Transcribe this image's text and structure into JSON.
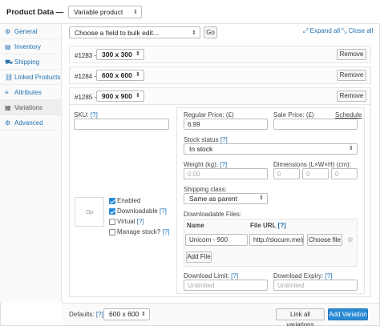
{
  "header": {
    "title": "Product Data —",
    "product_type": "Variable product"
  },
  "sidebar": {
    "items": [
      {
        "label": "General",
        "icon": "wrench-icon",
        "glyph": "⚙"
      },
      {
        "label": "Inventory",
        "icon": "inventory-icon",
        "glyph": "▤"
      },
      {
        "label": "Shipping",
        "icon": "truck-icon",
        "glyph": "⛟"
      },
      {
        "label": "Linked Products",
        "icon": "link-icon",
        "glyph": "⛓"
      },
      {
        "label": "Attributes",
        "icon": "list-icon",
        "glyph": "≡"
      },
      {
        "label": "Variations",
        "icon": "grid-icon",
        "glyph": "▦"
      },
      {
        "label": "Advanced",
        "icon": "gear-icon",
        "glyph": "⚙"
      }
    ],
    "active": "Variations"
  },
  "toolbar": {
    "bulk_select": "Choose a field to bulk edit...",
    "go_label": "Go",
    "expand_all": "Expand all",
    "close_all": "Close all"
  },
  "variations": [
    {
      "id": "#1283 —",
      "size": "300 x 300",
      "remove": "Remove"
    },
    {
      "id": "#1284 —",
      "size": "600 x 600",
      "remove": "Remove"
    },
    {
      "id": "#1285 —",
      "size": "900 x 900",
      "remove": "Remove"
    }
  ],
  "details": {
    "sku_label": "SKU:",
    "help": "[?]",
    "image_placeholder": "Op",
    "enabled_label": "Enabled",
    "downloadable_label": "Downloadable",
    "virtual_label": "Virtual",
    "manage_stock_label": "Manage stock?",
    "regular_price_label": "Regular Price: (£)",
    "regular_price_value": "6.99",
    "sale_price_label": "Sale Price: (£)",
    "schedule": "Schedule",
    "stock_status_label": "Stock status",
    "stock_status_value": "In stock",
    "weight_label": "Weight (kg):",
    "weight_placeholder": "0.00",
    "dimensions_label": "Dimensions (L×W×H) (cm):",
    "dim_placeholder": "0",
    "shipping_class_label": "Shipping class:",
    "shipping_class_value": "Same as parent",
    "downloadable_files_label": "Downloadable Files:",
    "col_name": "Name",
    "col_url": "File URL",
    "file_name": "Unicorn - 900",
    "file_url": "http://slocum.me/p",
    "choose_file": "Choose file",
    "add_file": "Add File",
    "download_limit_label": "Download Limit:",
    "download_limit_placeholder": "Unlimited",
    "download_expiry_label": "Download Expiry:",
    "download_expiry_placeholder": "Unlimited"
  },
  "footer": {
    "defaults_label": "Defaults:",
    "help": "[?]",
    "default_value": "600 x 600",
    "link_all": "Link all variations",
    "add_variation": "Add Variation"
  },
  "colors": {
    "accent": "#2a8ad4",
    "link": "#2271b1"
  }
}
